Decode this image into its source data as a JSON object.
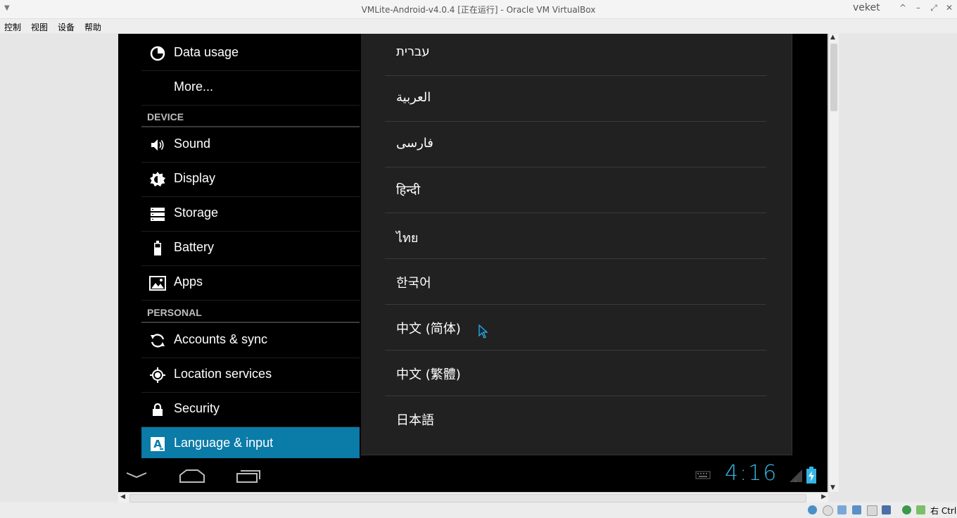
{
  "window": {
    "title": "VMLite-Android-v4.0.4 [正在运行] - Oracle VM VirtualBox",
    "user": "veket",
    "buttons": [
      "^",
      "–",
      "⤢",
      "✕"
    ]
  },
  "menubar": {
    "items": [
      "控制",
      "视图",
      "设备",
      "帮助"
    ]
  },
  "settings": {
    "items_top": [
      {
        "label": "Data usage",
        "icon": "data-usage-icon"
      },
      {
        "label": "More...",
        "icon": ""
      }
    ],
    "device_header": "DEVICE",
    "device_items": [
      {
        "label": "Sound",
        "icon": "speaker-icon"
      },
      {
        "label": "Display",
        "icon": "brightness-icon"
      },
      {
        "label": "Storage",
        "icon": "storage-icon"
      },
      {
        "label": "Battery",
        "icon": "battery-icon"
      },
      {
        "label": "Apps",
        "icon": "apps-icon"
      }
    ],
    "personal_header": "PERSONAL",
    "personal_items": [
      {
        "label": "Accounts & sync",
        "icon": "sync-icon"
      },
      {
        "label": "Location services",
        "icon": "location-icon"
      },
      {
        "label": "Security",
        "icon": "lock-icon"
      },
      {
        "label": "Language & input",
        "icon": "language-icon",
        "selected": true
      }
    ]
  },
  "languages": [
    "עברית",
    "العربية",
    "فارسی",
    "हिन्दी",
    "ไทย",
    "한국어",
    "中文 (简体)",
    "中文 (繁體)",
    "日本語"
  ],
  "navbar": {
    "clock": "4:16",
    "accent": "#33b5e5"
  },
  "colors": {
    "selection": "#0b7ba8",
    "android_bg": "#000000",
    "pane_bg": "#212121"
  }
}
